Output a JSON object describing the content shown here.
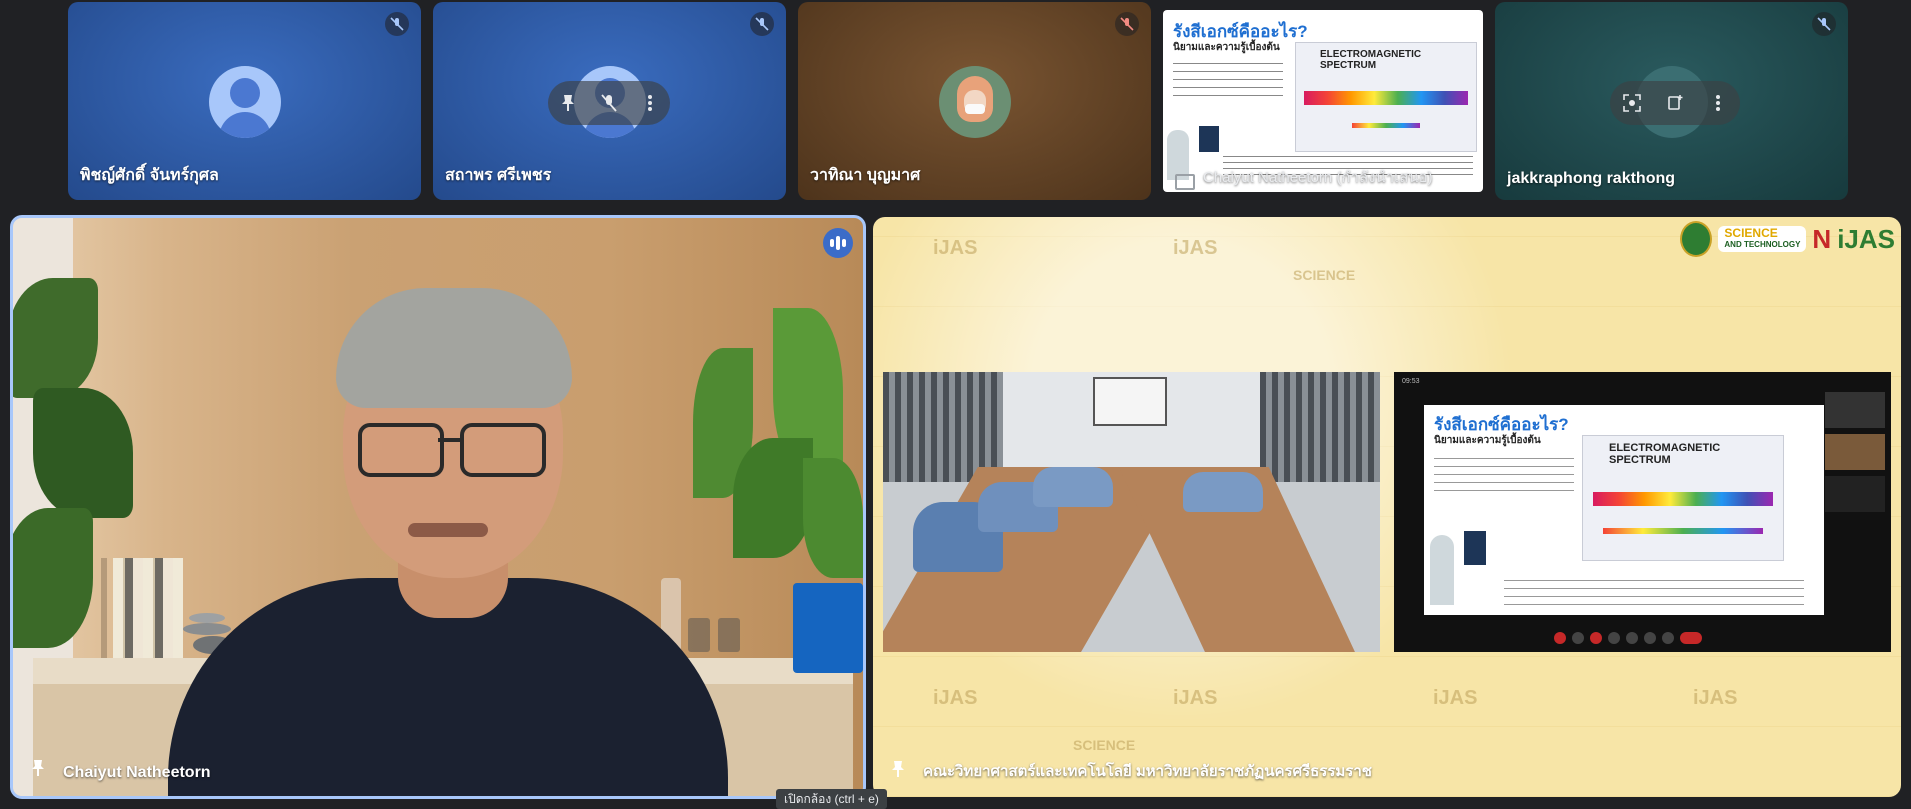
{
  "participants": [
    {
      "name": "พิชญ์ศักดิ์ จันทร์กุศล",
      "muted": true
    },
    {
      "name": "สถาพร ศรีเพชร",
      "muted": true
    },
    {
      "name": "วาทิณา บุญมาศ",
      "muted": true
    },
    {
      "name": "Chaiyut Natheetorn (กำลังนำเสนอ)",
      "muted": false
    },
    {
      "name": "jakkraphong rakthong",
      "muted": true
    }
  ],
  "mini_slide": {
    "title": "รังสีเอกซ์คืออะไร?",
    "subtitle": "นิยามและความรู้เบื้องต้น",
    "spectrum_label": "ELECTROMAGNETIC SPECTRUM"
  },
  "main_speaker": {
    "name": "Chaiyut Natheetorn"
  },
  "presentation": {
    "caption": "คณะวิทยาศาสตร์และเทคโนโลยี มหาวิทยาลัยราชภัฏนครศรีธรรมราช",
    "brand_1": "iJAS",
    "brand_2": "SCIENCE",
    "brand_3": "AND TECHNOLOGY",
    "inner_slide_title": "รังสีเอกซ์คืออะไร?",
    "inner_slide_subtitle": "นิยามและความรู้เบื้องต้น",
    "inner_spectrum_label": "ELECTROMAGNETIC SPECTRUM",
    "inner_clock": "09:53"
  },
  "tooltip": "เปิดกล้อง (ctrl + e)",
  "colors": {
    "bg": "#202124",
    "blue_tile": "#2f5ea9",
    "active_border": "#a8c7fa",
    "brown_tile": "#6b4a2a",
    "teal_tile": "#1f4a4e"
  }
}
